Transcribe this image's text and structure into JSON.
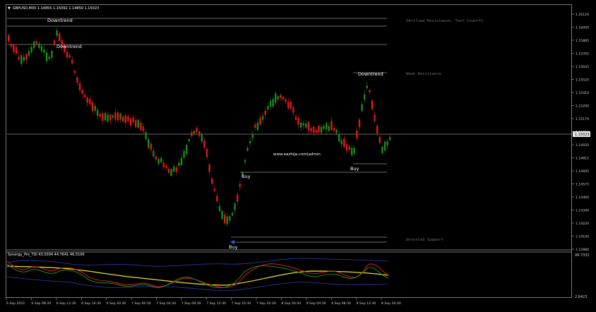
{
  "window": {
    "symbol_header": "GBPUSD,M30  1.14855 1.15092 1.14850 1.15023"
  },
  "levels": [
    {
      "label": "Verified Resistance, Test Count=1",
      "price": 1.1603
    },
    {
      "label": "Weak Resistance",
      "price": 1.15545
    },
    {
      "label": "Untested Support",
      "price": 1.14105
    }
  ],
  "annotations": {
    "downtrend_1": "Downtrend",
    "downtrend_2": "Downtrend",
    "downtrend_3": "Downtrend",
    "buy_1": "Buy",
    "buy_2": "Buy",
    "buy_3": "Buy",
    "watermark": "www.eazhija.com|admin"
  },
  "price_axis": {
    "labels": [
      "1.16120",
      "1.16000",
      "1.15885",
      "1.15765",
      "1.15645",
      "1.15525",
      "1.15410",
      "1.15290",
      "1.15170",
      "1.15050",
      "1.14935",
      "1.14815",
      "1.14695",
      "1.14575",
      "1.14460",
      "1.14340",
      "1.14220",
      "1.14100",
      "1.13980"
    ],
    "current_price": "1.15023"
  },
  "indicator": {
    "header": "Synergy_Pro_TDI 43.0304 44.7641 46.5100",
    "axis_top": "99.7331",
    "axis_bottom": "2.6423"
  },
  "time_axis": {
    "labels": [
      "6 Sep 2022",
      "6 Sep 08:30",
      "6 Sep 12:30",
      "6 Sep 16:30",
      "6 Sep 20:30",
      "7 Sep 00:30",
      "7 Sep 04:30",
      "7 Sep 08:30",
      "7 Sep 12:30",
      "7 Sep 16:30",
      "7 Sep 20:30",
      "8 Sep 00:30",
      "8 Sep 04:30",
      "8 Sep 08:30",
      "8 Sep 12:30",
      "8 Sep 16:30"
    ]
  },
  "colors": {
    "bull": "#1e8a1e",
    "bear": "#e01a1a",
    "level_line": "#cfcfcf",
    "zone_text": "#6f6f6f",
    "tdi_yellow": "#e8e02a",
    "tdi_band": "#2b3fb5"
  }
}
